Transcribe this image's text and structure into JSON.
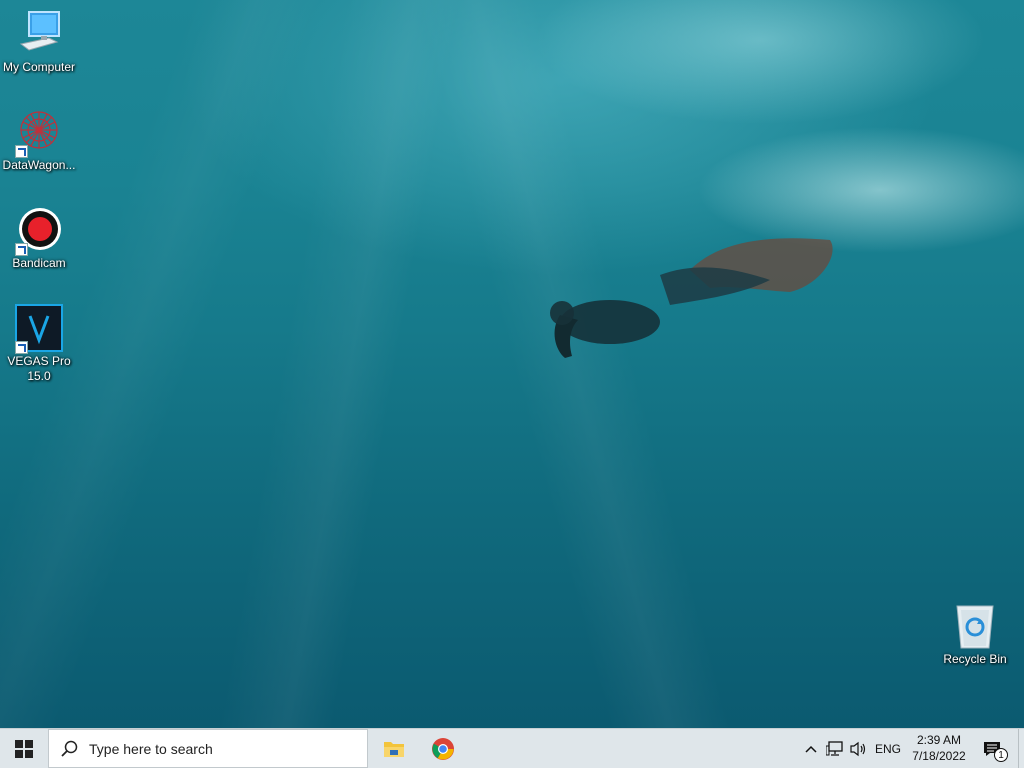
{
  "desktop": {
    "icons": [
      {
        "label": "My Computer",
        "icon": "computer-icon"
      },
      {
        "label": "DataWagon...",
        "icon": "datawagon-icon"
      },
      {
        "label": "Bandicam",
        "icon": "bandicam-icon"
      },
      {
        "label": "VEGAS Pro 15.0",
        "icon": "vegas-pro-icon"
      },
      {
        "label": "Recycle Bin",
        "icon": "recycle-bin-icon"
      }
    ]
  },
  "taskbar": {
    "start_icon": "windows-logo-icon",
    "search": {
      "placeholder": "Type here to search",
      "icon": "search-icon"
    },
    "apps": [
      {
        "name": "File Explorer",
        "icon": "file-explorer-icon"
      },
      {
        "name": "Google Chrome",
        "icon": "chrome-icon"
      }
    ],
    "tray": {
      "language": "ENG",
      "time": "2:39 AM",
      "date": "7/18/2022",
      "notification_count": "1"
    }
  },
  "colors": {
    "taskbar_bg": "#dfe6ea",
    "water_top": "#1d8797",
    "water_bottom": "#0b5a70",
    "bandicam_red": "#e8212b",
    "vegas_blue": "#1aa6e6"
  }
}
